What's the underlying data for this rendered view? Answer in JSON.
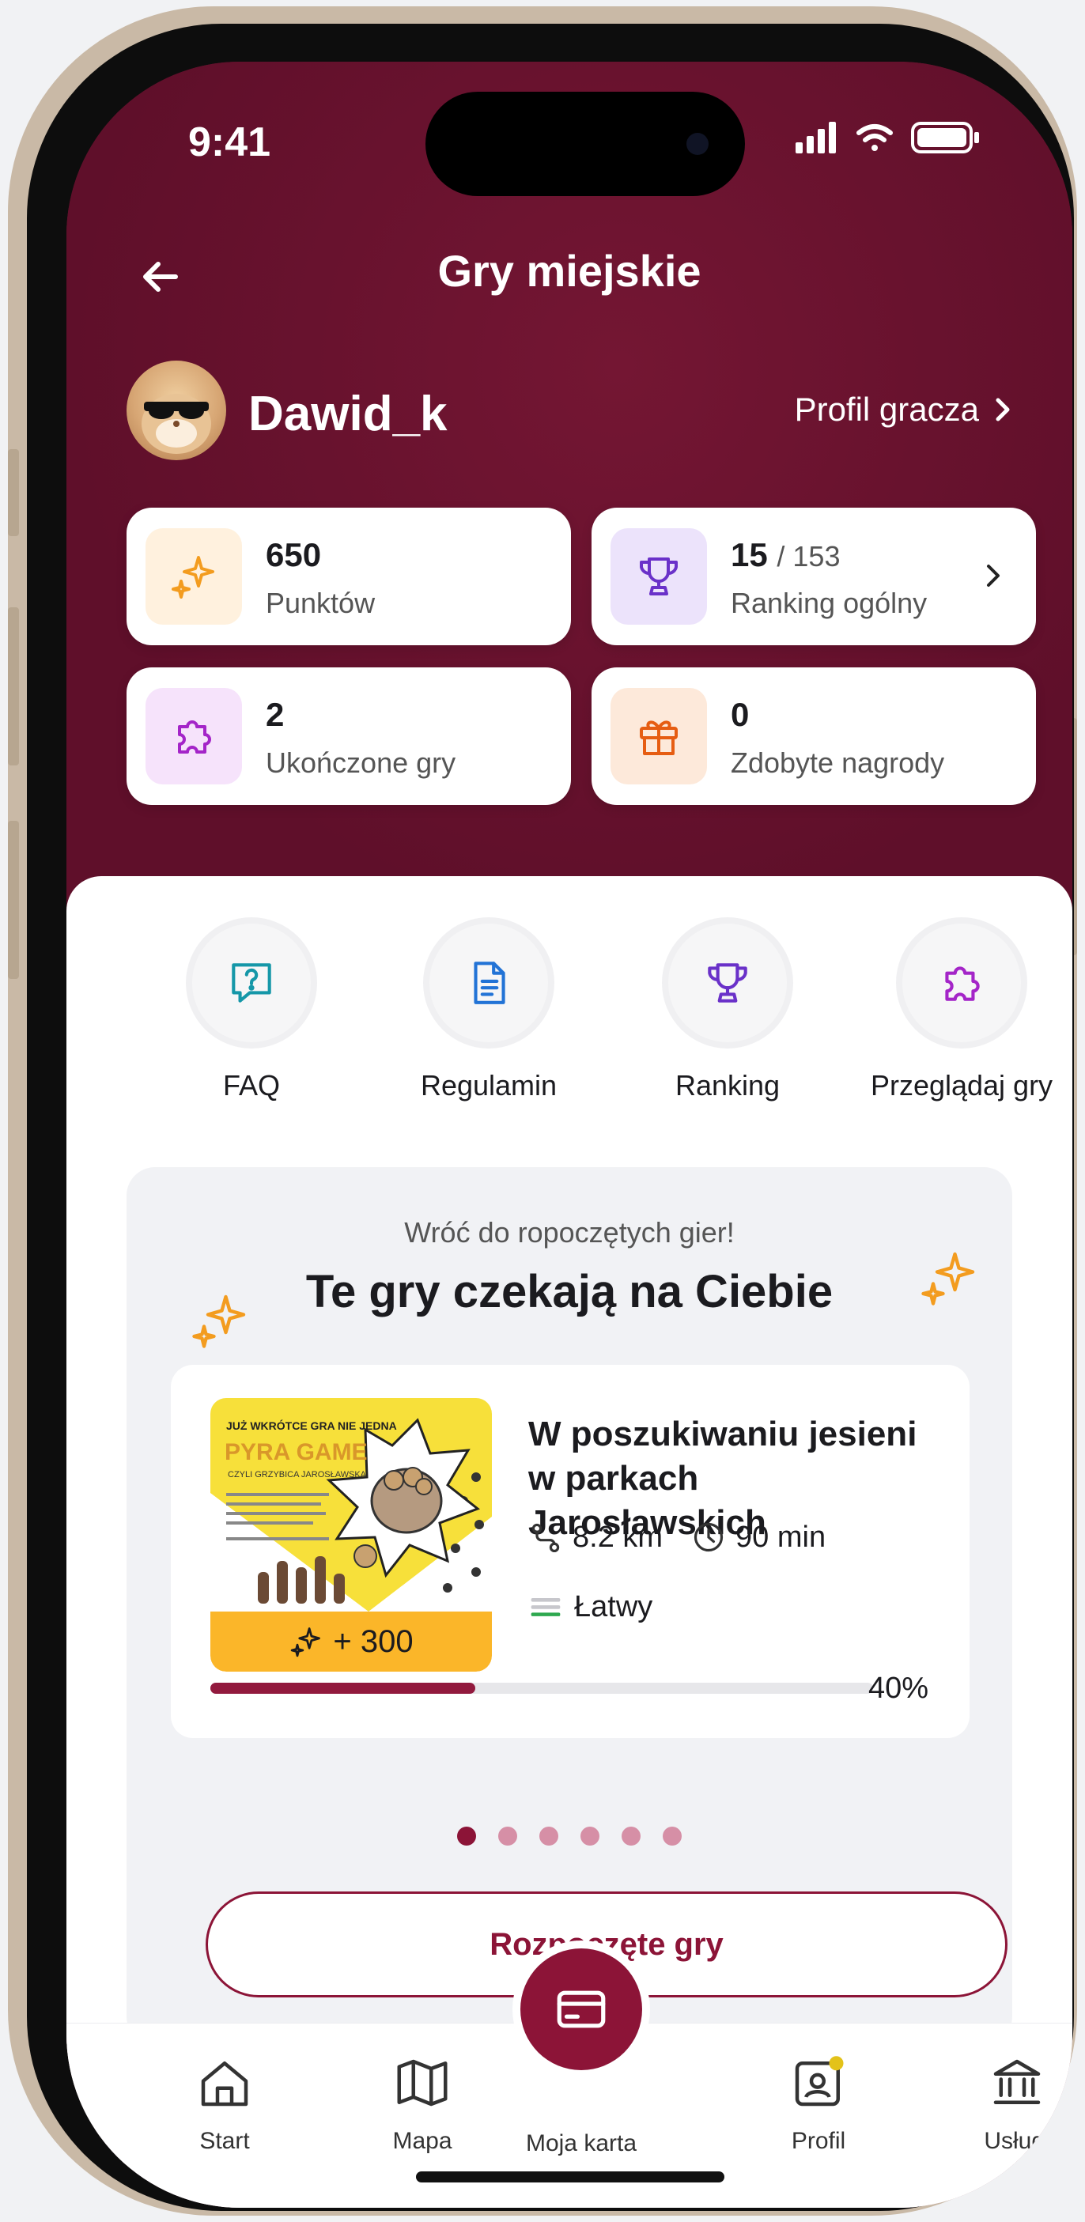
{
  "status": {
    "time": "9:41"
  },
  "header": {
    "title": "Gry miejskie"
  },
  "player": {
    "username": "Dawid_k",
    "profile_link": "Profil gracza"
  },
  "stats": [
    {
      "value": "650",
      "label": "Punktów",
      "icon": "sparkles-icon",
      "color": "#f39c1f",
      "bg": "#fff1de"
    },
    {
      "value": "15",
      "value_suffix": "/ 153",
      "label": "Ranking ogólny",
      "icon": "trophy-icon",
      "color": "#6a31c9",
      "bg": "#ece3fb"
    },
    {
      "value": "2",
      "label": "Ukończone gry",
      "icon": "puzzle-icon",
      "color": "#a425c8",
      "bg": "#f6e3fb"
    },
    {
      "value": "0",
      "label": "Zdobyte nagrody",
      "icon": "gift-icon",
      "color": "#e65d12",
      "bg": "#fde9da"
    }
  ],
  "quick_actions": [
    {
      "label": "FAQ",
      "icon": "question-icon",
      "color": "#1597a8"
    },
    {
      "label": "Regulamin",
      "icon": "document-icon",
      "color": "#2273d6"
    },
    {
      "label": "Ranking",
      "icon": "trophy-icon",
      "color": "#6a31c9"
    },
    {
      "label": "Przeglądaj gry",
      "icon": "puzzle-icon",
      "color": "#a425c8"
    }
  ],
  "continue_section": {
    "subtitle": "Wróć do ropoczętych gier!",
    "title": "Te gry czekają na Ciebie",
    "game": {
      "title": "W poszukiwaniu jesieni w parkach Jarosławskich",
      "distance": "8.2 km",
      "duration": "90 min",
      "difficulty": "Łatwy",
      "points": "+ 300",
      "progress_percent": 40,
      "progress_label": "40%",
      "poster": {
        "headline": "JUŻ WKRÓTCE GRA NIE JEDNA",
        "brand": "PYRA GAME",
        "tagline": "CZYLI GRZYBICA JAROSŁAWSKA"
      }
    },
    "pager": {
      "count": 6,
      "active": 0
    },
    "button_label": "Rozpoczęte gry"
  },
  "tabbar": {
    "items": [
      {
        "label": "Start",
        "icon": "home-icon"
      },
      {
        "label": "Mapa",
        "icon": "map-icon"
      },
      {
        "label": "Moja karta",
        "icon": "card-icon"
      },
      {
        "label": "Profil",
        "icon": "profile-badge-icon"
      },
      {
        "label": "Usługi",
        "icon": "bank-icon"
      }
    ]
  },
  "colors": {
    "brand": "#8c1437",
    "header_bg": "#6e1230",
    "accent_yellow": "#fbb629"
  }
}
